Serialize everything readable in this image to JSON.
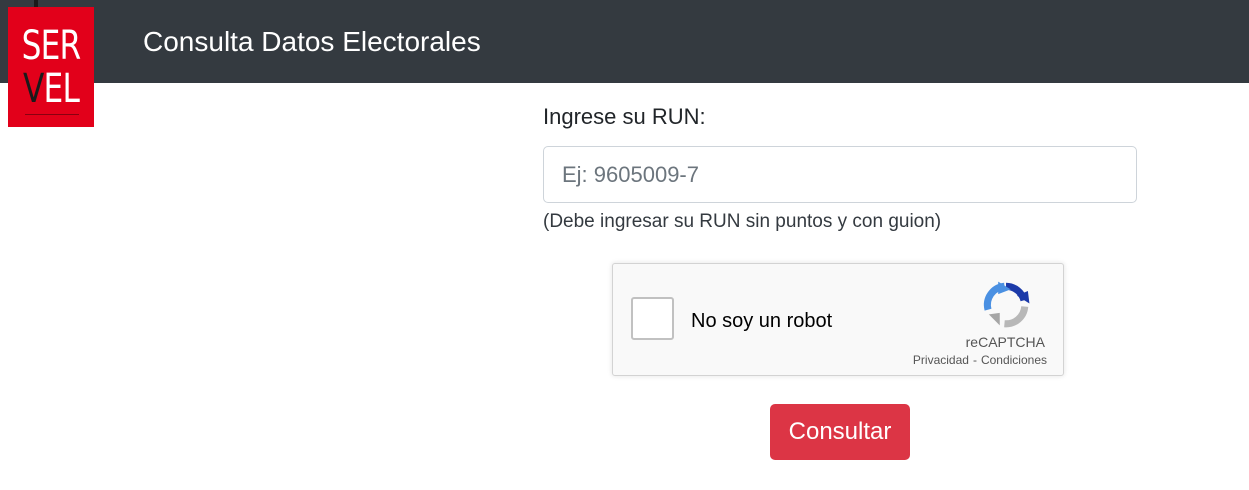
{
  "header": {
    "logo_top": "SER",
    "logo_bottom_1": "V",
    "logo_bottom_2": "EL",
    "title": "Consulta Datos Electorales"
  },
  "form": {
    "run_label": "Ingrese su RUN:",
    "run_placeholder": "Ej: 9605009-7",
    "run_value": "",
    "run_help": "(Debe ingresar su RUN sin puntos y con guion)",
    "submit_label": "Consultar"
  },
  "captcha": {
    "checkbox_label": "No soy un robot",
    "brand": "reCAPTCHA",
    "privacy_link": "Privacidad",
    "separator": "-",
    "terms_link": "Condiciones",
    "checked": false
  },
  "colors": {
    "navbar": "#343a40",
    "logo_red": "#e2001a",
    "button_red": "#dc3545"
  }
}
